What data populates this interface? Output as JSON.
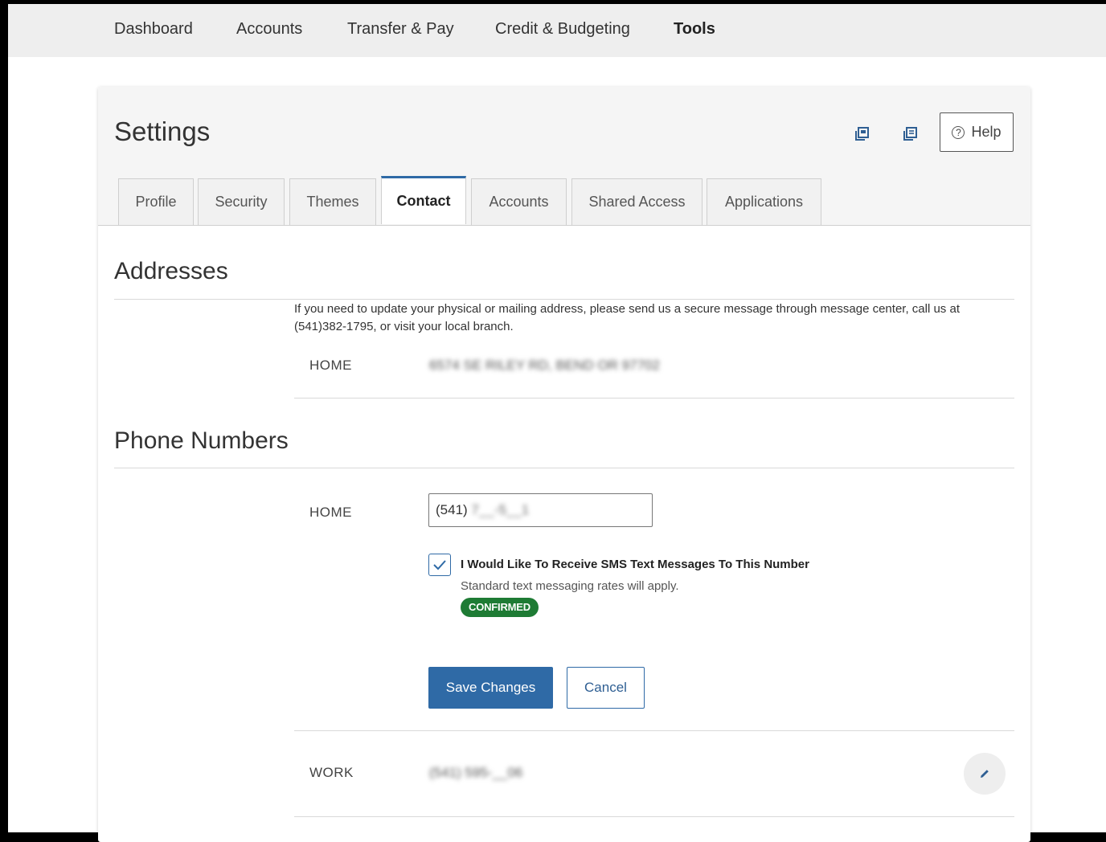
{
  "topnav": {
    "items": [
      {
        "label": "Dashboard",
        "active": false
      },
      {
        "label": "Accounts",
        "active": false
      },
      {
        "label": "Transfer & Pay",
        "active": false
      },
      {
        "label": "Credit & Budgeting",
        "active": false
      },
      {
        "label": "Tools",
        "active": true
      }
    ]
  },
  "page": {
    "title": "Settings",
    "help_label": "Help",
    "icons": [
      "print-icon",
      "print-preview-icon",
      "help-circle-icon",
      "checkmark-icon",
      "pencil-icon"
    ]
  },
  "tabs": [
    {
      "label": "Profile",
      "active": false
    },
    {
      "label": "Security",
      "active": false
    },
    {
      "label": "Themes",
      "active": false
    },
    {
      "label": "Contact",
      "active": true
    },
    {
      "label": "Accounts",
      "active": false
    },
    {
      "label": "Shared Access",
      "active": false
    },
    {
      "label": "Applications",
      "active": false
    }
  ],
  "addresses": {
    "title": "Addresses",
    "note": "If you need to update your physical or mailing address, please send us a secure message through message center, call us at (541)382-1795, or visit your local branch.",
    "home_label": "HOME",
    "home_value": "6574 SE RILEY RD, BEND OR 97702"
  },
  "phones": {
    "title": "Phone Numbers",
    "home_label": "HOME",
    "home_prefix": "(541) ",
    "home_rest": "7__-5__1",
    "sms_label": "I Would Like To Receive SMS Text Messages To This Number",
    "sms_checked": true,
    "sms_sub": "Standard text messaging rates will apply.",
    "badge": "CONFIRMED",
    "save_label": "Save Changes",
    "cancel_label": "Cancel",
    "work_label": "WORK",
    "work_value": "(541) 595-__06"
  },
  "colors": {
    "primary": "#2f6aa6",
    "badge_green": "#1e7b34",
    "nav_bg": "#eeeeee"
  }
}
